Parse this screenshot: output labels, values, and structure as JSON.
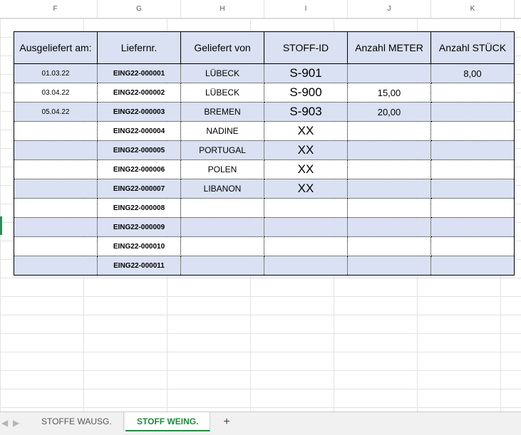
{
  "columns": [
    "F",
    "G",
    "H",
    "I",
    "J",
    "K"
  ],
  "headers": [
    "Ausgeliefert am:",
    "Liefernr.",
    "Geliefert von",
    "STOFF-ID",
    "Anzahl METER",
    "Anzahl STÜCK"
  ],
  "rows": [
    {
      "date": "01.03.22",
      "lief": "EING22-000001",
      "von": "LÜBECK",
      "stoff": "S-901",
      "meter": "",
      "stueck": "8,00"
    },
    {
      "date": "03.04.22",
      "lief": "EING22-000002",
      "von": "LÜBECK",
      "stoff": "S-900",
      "meter": "15,00",
      "stueck": ""
    },
    {
      "date": "05.04.22",
      "lief": "EING22-000003",
      "von": "BREMEN",
      "stoff": "S-903",
      "meter": "20,00",
      "stueck": ""
    },
    {
      "date": "",
      "lief": "EING22-000004",
      "von": "NADINE",
      "stoff": "XX",
      "meter": "",
      "stueck": ""
    },
    {
      "date": "",
      "lief": "EING22-000005",
      "von": "PORTUGAL",
      "stoff": "XX",
      "meter": "",
      "stueck": ""
    },
    {
      "date": "",
      "lief": "EING22-000006",
      "von": "POLEN",
      "stoff": "XX",
      "meter": "",
      "stueck": ""
    },
    {
      "date": "",
      "lief": "EING22-000007",
      "von": "LIBANON",
      "stoff": "XX",
      "meter": "",
      "stueck": ""
    },
    {
      "date": "",
      "lief": "EING22-000008",
      "von": "",
      "stoff": "",
      "meter": "",
      "stueck": ""
    },
    {
      "date": "",
      "lief": "EING22-000009",
      "von": "",
      "stoff": "",
      "meter": "",
      "stueck": ""
    },
    {
      "date": "",
      "lief": "EING22-000010",
      "von": "",
      "stoff": "",
      "meter": "",
      "stueck": ""
    },
    {
      "date": "",
      "lief": "EING22-000011",
      "von": "",
      "stoff": "",
      "meter": "",
      "stueck": ""
    }
  ],
  "tabs": {
    "tab1": "STOFFE WAUSG.",
    "tab2": "STOFF WEING.",
    "add": "+",
    "nav_left": "◀",
    "nav_right": "▶"
  },
  "colors": {
    "header_fill": "#d9e1f2",
    "stripe": "#d9e1f2",
    "active_tab": "#1f8a3c"
  }
}
